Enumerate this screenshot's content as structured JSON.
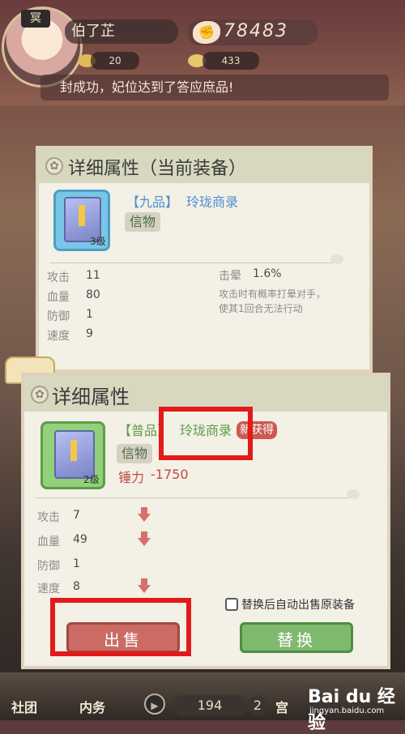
{
  "topbar": {
    "avatar_tag": "冥",
    "player_name": "伯了芷",
    "power_value": "78483",
    "resource_1": "20",
    "resource_2": "433",
    "notice": "封成功，妃位达到了答应庶品!"
  },
  "current_panel": {
    "title": "详细属性（当前装备）",
    "item_grade": "【九品】",
    "item_name": "玲珑商录",
    "item_type": "信物",
    "item_level": "3级",
    "stats": [
      {
        "label": "攻击",
        "value": "11"
      },
      {
        "label": "血量",
        "value": "80"
      },
      {
        "label": "防御",
        "value": "1"
      },
      {
        "label": "速度",
        "value": "9"
      }
    ],
    "extra_label": "击晕",
    "extra_value": "1.6%",
    "extra_desc_1": "攻击时有概率打晕对手，",
    "extra_desc_2": "使其1回合无法行动"
  },
  "detail_panel": {
    "title": "详细属性",
    "item_grade": "【普品】",
    "item_name": "玲珑商录",
    "new_badge": "新获得",
    "item_type": "信物",
    "item_level": "2级",
    "sell_price_label": "锤力",
    "sell_price_value": "-1750",
    "stats": [
      {
        "label": "攻击",
        "value": "7",
        "down": true
      },
      {
        "label": "血量",
        "value": "49",
        "down": true
      },
      {
        "label": "防御",
        "value": "1",
        "down": false
      },
      {
        "label": "速度",
        "value": "8",
        "down": true
      }
    ],
    "auto_sell_label": "替换后自动出售原装备",
    "sell_button": "出售",
    "replace_button": "替换"
  },
  "bottom_bar": {
    "item_1": "社团",
    "item_2": "内务",
    "counter_1": "194",
    "counter_2": "2",
    "item_3": "宫"
  },
  "watermark": {
    "brand": "Bai du 经验",
    "url": "jingyan.baidu.com"
  },
  "colors": {
    "panel_header": "#d7d8bf",
    "sell_button": "#cc6b63",
    "replace_button": "#7fb96e",
    "highlight_box": "#e21a1a"
  }
}
